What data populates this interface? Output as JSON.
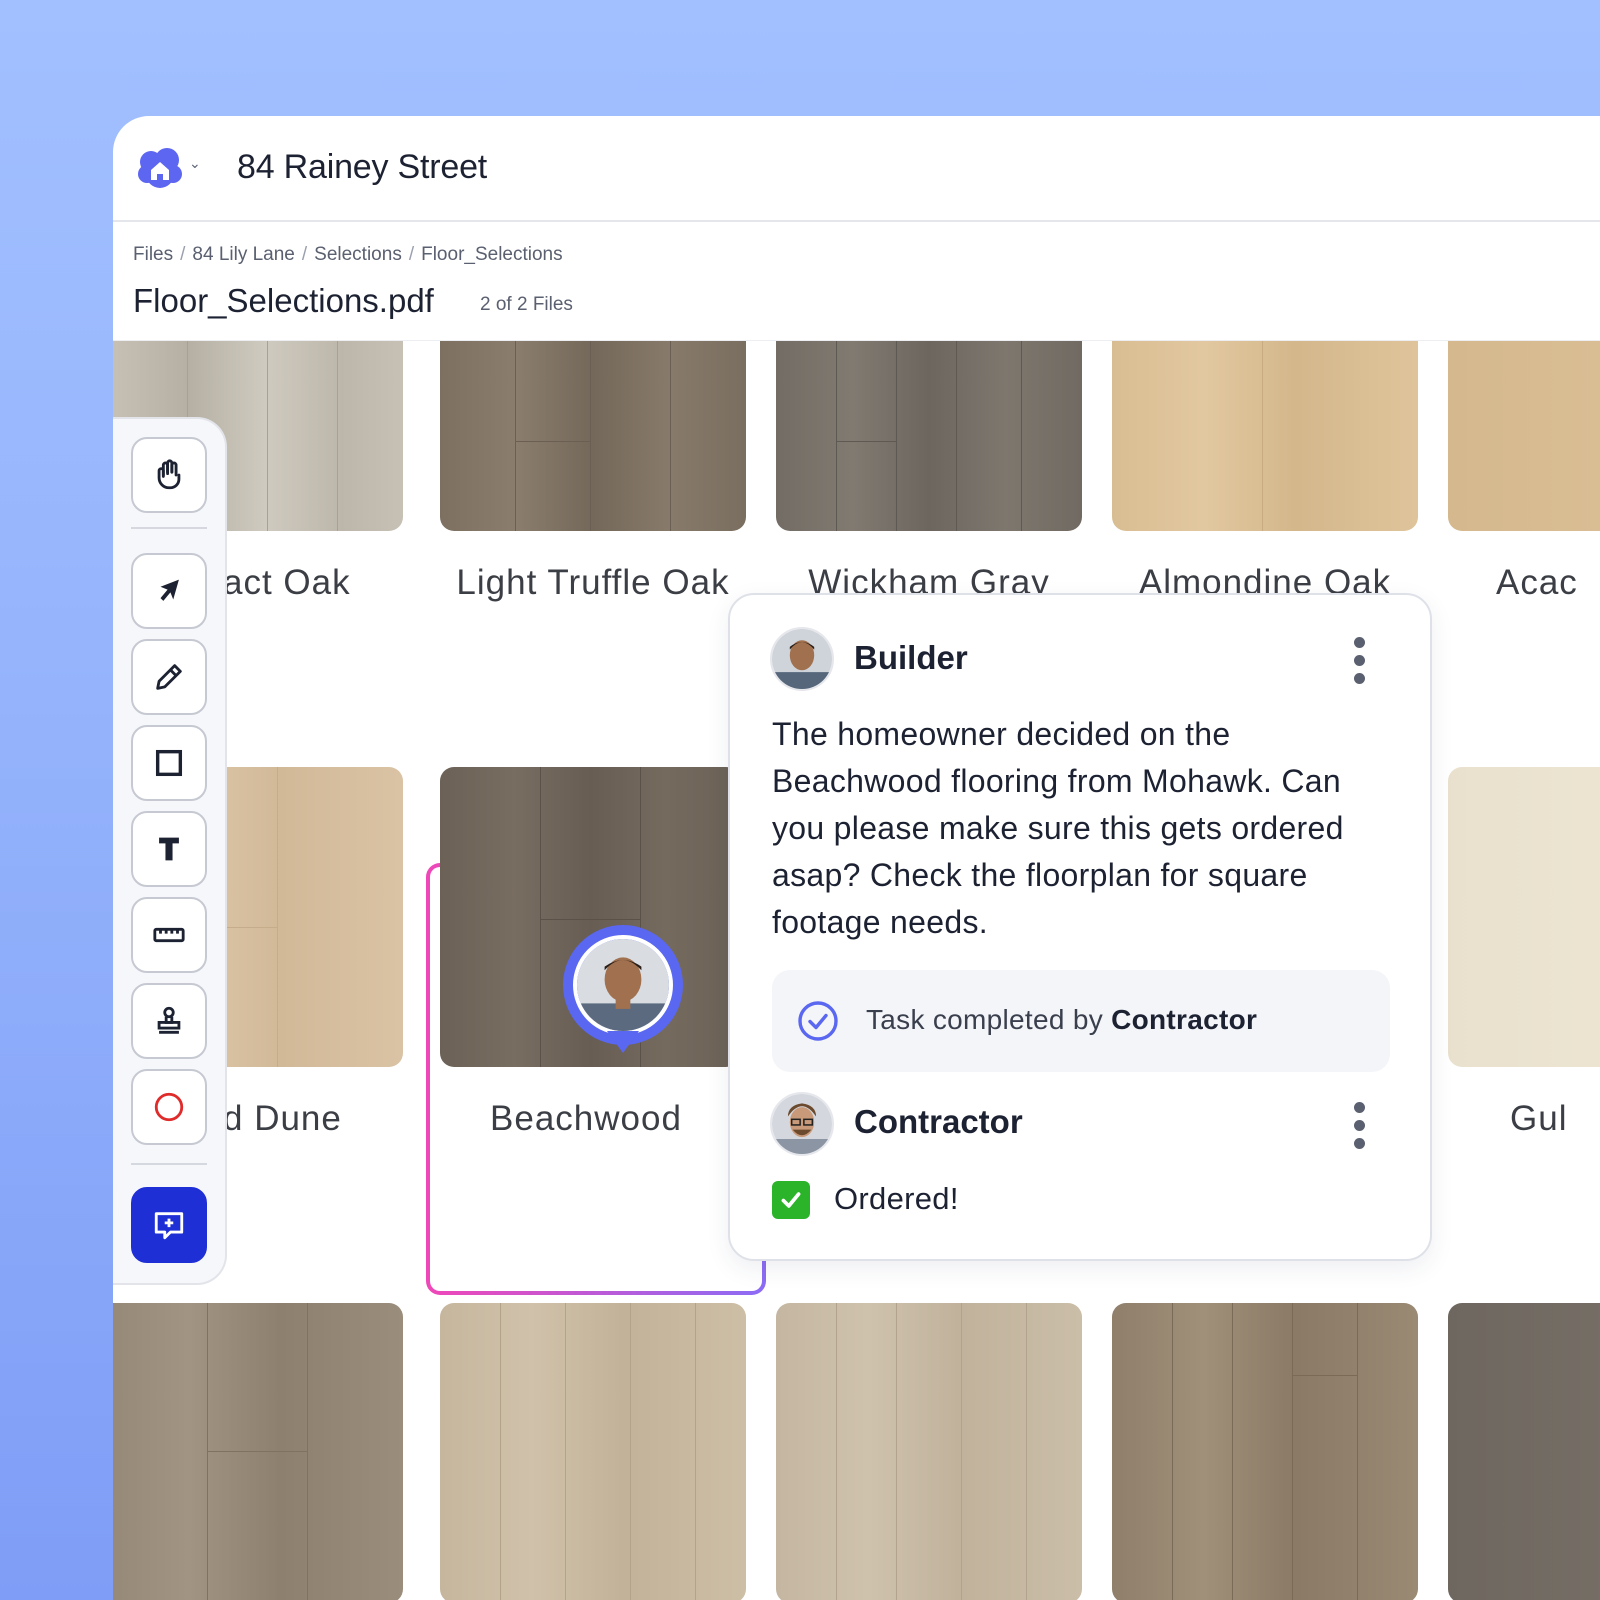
{
  "app": {
    "project_title": "84 Rainey Street"
  },
  "breadcrumb": [
    "Files",
    "84 Lily Lane",
    "Selections",
    "Floor_Selections"
  ],
  "file": {
    "name": "Floor_Selections.pdf",
    "count": "2 of 2 Files"
  },
  "floors_row1": [
    "act Oak",
    "Light Truffle Oak",
    "Wickham Gray",
    "Almondine Oak",
    "Acac"
  ],
  "floors_row2": [
    "d Dune",
    "Beachwood",
    "Gul"
  ],
  "toolbar": {
    "tools": [
      "hand-icon",
      "arrow-icon",
      "pencil-icon",
      "square-icon",
      "text-icon",
      "ruler-icon",
      "stamp-icon",
      "circle-icon",
      "add-comment-icon"
    ]
  },
  "comment": {
    "author": "Builder",
    "body": "The homeowner decided on the Beachwood flooring from Mohawk. Can you please make sure this gets ordered asap? Check the floorplan for square footage needs.",
    "task_prefix": "Task completed by ",
    "task_by": "Contractor",
    "reply_author": "Contractor",
    "reply_body": "Ordered!"
  },
  "colors": {
    "accent": "#1f2fd6",
    "pin": "#5a67f0",
    "highlight_start": "#ef47b8",
    "highlight_end": "#8b6cf5"
  }
}
